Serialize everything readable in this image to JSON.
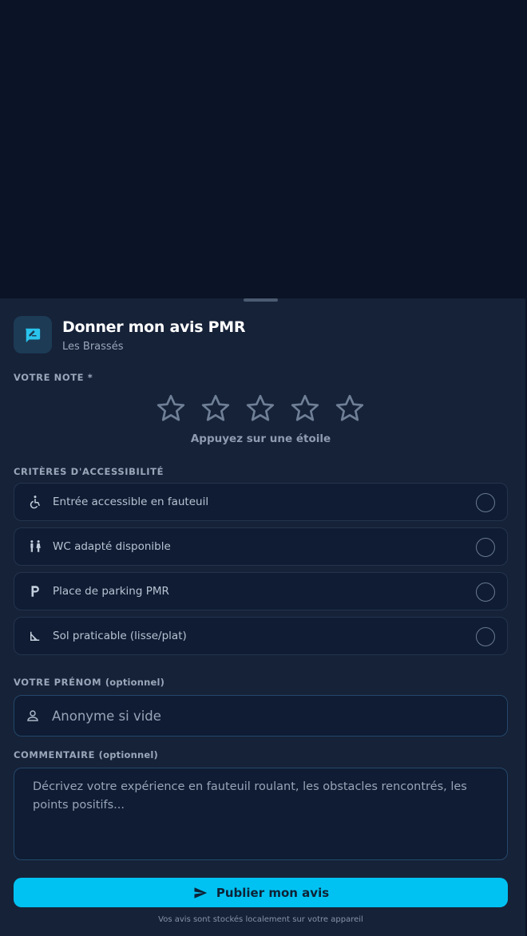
{
  "sheet": {
    "title": "Donner mon avis PMR",
    "subtitle": "Les Brassés"
  },
  "rating": {
    "label": "VOTRE NOTE *",
    "hint": "Appuyez sur une étoile",
    "value": 0,
    "max": 5
  },
  "criteria": {
    "label": "CRITÈRES D'ACCESSIBILITÉ",
    "items": [
      {
        "label": "Entrée accessible en fauteuil",
        "icon": "wheelchair-icon",
        "checked": false
      },
      {
        "label": "WC adapté disponible",
        "icon": "restroom-icon",
        "checked": false
      },
      {
        "label": "Place de parking PMR",
        "icon": "parking-icon",
        "checked": false
      },
      {
        "label": "Sol praticable (lisse/plat)",
        "icon": "floor-angle-icon",
        "checked": false
      }
    ]
  },
  "name_field": {
    "label": "VOTRE PRÉNOM",
    "optional": "(optionnel)",
    "placeholder": "Anonyme si vide",
    "value": ""
  },
  "comment_field": {
    "label": "COMMENTAIRE",
    "optional": "(optionnel)",
    "placeholder": "Décrivez votre expérience en fauteuil roulant, les obstacles rencontrés, les points positifs...",
    "value": ""
  },
  "publish_button": {
    "label": "Publier mon avis",
    "icon": "send-icon"
  },
  "footnote": "Vos avis sont stockés localement sur votre appareil",
  "colors": {
    "background": "#0b1426",
    "sheet": "#162238",
    "accent": "#00c2f2",
    "star_outline": "#6f7f96"
  }
}
